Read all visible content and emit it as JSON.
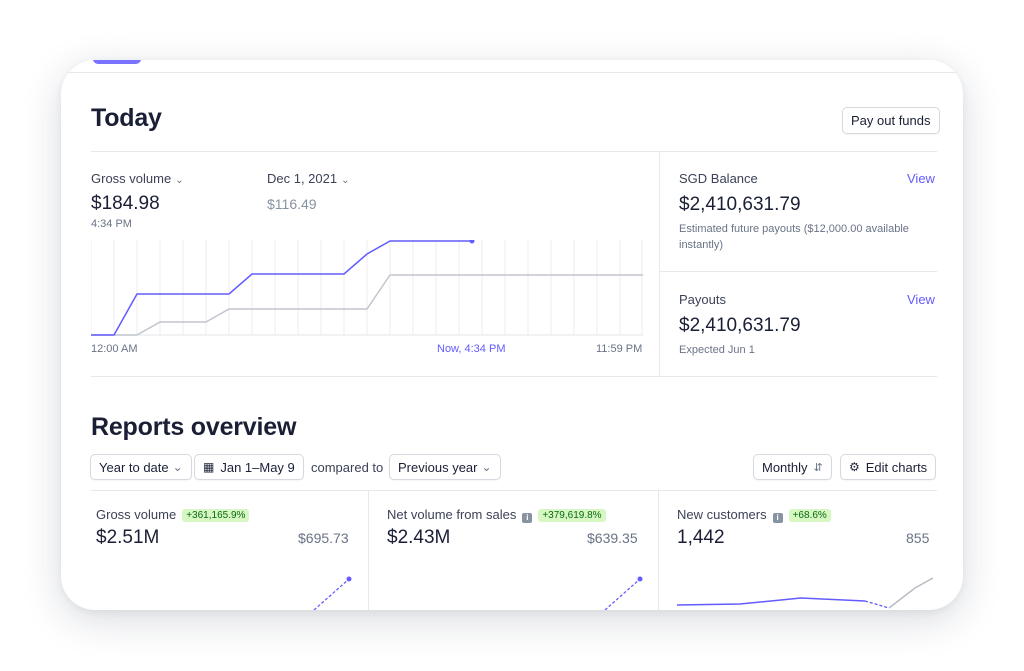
{
  "today": {
    "title": "Today",
    "payout_button": "Pay out funds",
    "gross_label": "Gross volume",
    "gross_value": "$184.98",
    "gross_time": "4:34 PM",
    "compare_label": "Dec 1, 2021",
    "compare_value": "$116.49",
    "axis_start": "12:00 AM",
    "axis_now": "Now, 4:34 PM",
    "axis_end": "11:59 PM",
    "balance": {
      "title": "SGD Balance",
      "view": "View",
      "value": "$2,410,631.79",
      "note": "Estimated future payouts ($12,000.00 available instantly)"
    },
    "payouts": {
      "title": "Payouts",
      "view": "View",
      "value": "$2,410,631.79",
      "note": "Expected Jun 1"
    }
  },
  "reports": {
    "title": "Reports overview",
    "range": "Year to date",
    "dates": "Jan 1–May 9",
    "compared_to": "compared to",
    "compare_period": "Previous year",
    "interval": "Monthly",
    "edit": "Edit charts",
    "cards": [
      {
        "label": "Gross volume",
        "badge": "+361,165.9%",
        "value": "$2.51M",
        "prev": "$695.73"
      },
      {
        "label": "Net volume from sales",
        "badge": "+379,619.8%",
        "value": "$2.43M",
        "prev": "$639.35"
      },
      {
        "label": "New customers",
        "badge": "+68.6%",
        "value": "1,442",
        "prev": "855"
      }
    ]
  },
  "colors": {
    "accent": "#635bff",
    "compare_line": "#c1c5cd",
    "badge_bg": "#d7f7c2",
    "badge_text": "#05690d"
  }
}
